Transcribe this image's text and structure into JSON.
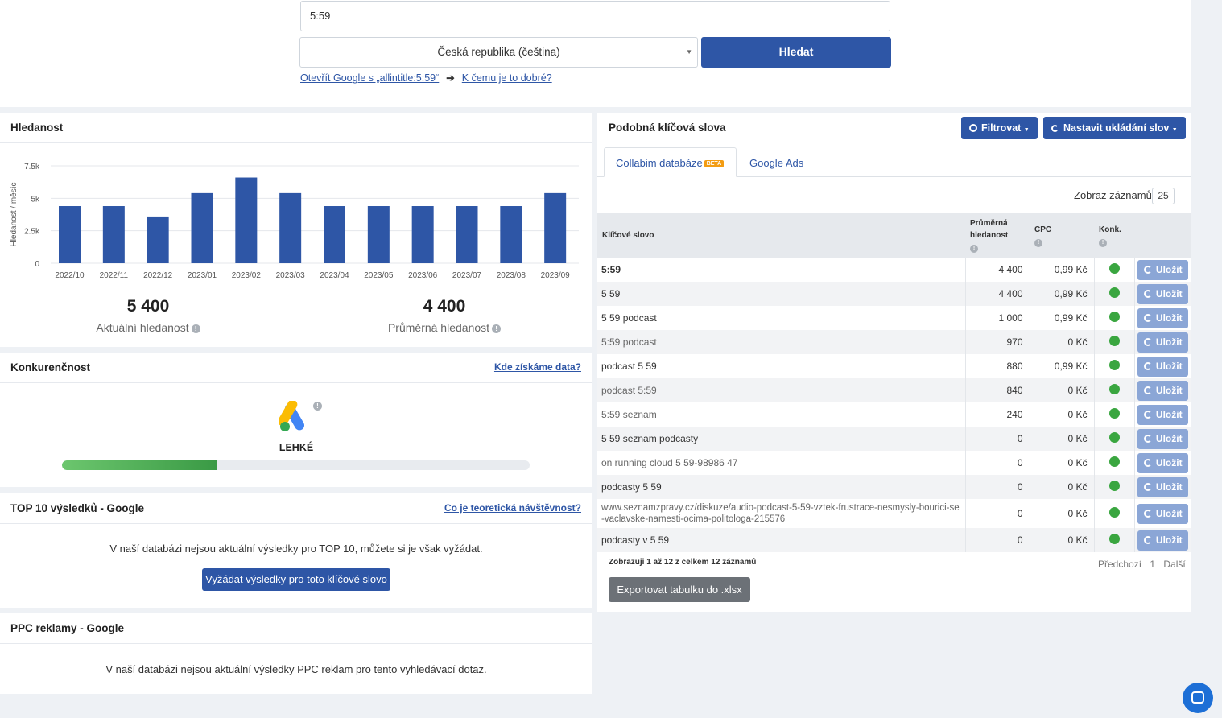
{
  "search": {
    "query": "5:59",
    "country": "Česká republika (čeština)",
    "button": "Hledat"
  },
  "links": {
    "allintitle": "Otevřít Google s „allintitle:5:59“",
    "arrow": "➔",
    "why": "K čemu je to dobré?"
  },
  "searchvolume": {
    "title": "Hledanost",
    "current_value": "5 400",
    "current_label": "Aktuální hledanost",
    "avg_value": "4 400",
    "avg_label": "Průměrná hledanost"
  },
  "chart_data": {
    "type": "bar",
    "categories": [
      "2022/10",
      "2022/11",
      "2022/12",
      "2023/01",
      "2023/02",
      "2023/03",
      "2023/04",
      "2023/05",
      "2023/06",
      "2023/07",
      "2023/08",
      "2023/09"
    ],
    "values": [
      4400,
      4400,
      3600,
      5400,
      6600,
      5400,
      4400,
      4400,
      4400,
      4400,
      4400,
      5400
    ],
    "ylabel": "Hledanost / měsíc",
    "yticks": [
      "0",
      "2.5k",
      "5k",
      "7.5k"
    ],
    "ylim": [
      0,
      7500
    ],
    "grid": true,
    "color": "#2e56a6"
  },
  "competition": {
    "title": "Konkurenčnost",
    "link": "Kde získáme data?",
    "level": "LEHKÉ",
    "level_fraction": 0.33
  },
  "top10": {
    "title": "TOP 10 výsledků - Google",
    "link": "Co je teoretická návštěvnost?",
    "message": "V naší databázi nejsou aktuální výsledky pro TOP 10, můžete si je však vyžádat.",
    "button": "Vyžádat výsledky pro toto klíčové slovo"
  },
  "ppc": {
    "title": "PPC reklamy - Google",
    "message": "V naší databázi nejsou aktuální výsledky PPC reklam pro tento vyhledávací dotaz."
  },
  "similar": {
    "title": "Podobná klíčová slova",
    "filter_button": "Filtrovat",
    "save_settings_button": "Nastavit ukládání slov",
    "tabs": [
      "Collabim databáze",
      "Google Ads"
    ],
    "beta": "BETA",
    "show_records_label": "Zobraz záznamů",
    "show_records_value": "25",
    "headers": {
      "keyword": "Klíčové slovo",
      "avg": "Průměrná hledanost",
      "cpc": "CPC",
      "comp": "Konk."
    },
    "save_label": "Uložit",
    "rows": [
      {
        "keyword": "5:59",
        "avg": "4 400",
        "cpc": "0,99 Kč"
      },
      {
        "keyword": "5 59",
        "avg": "4 400",
        "cpc": "0,99 Kč"
      },
      {
        "keyword": "5 59 podcast",
        "avg": "1 000",
        "cpc": "0,99 Kč"
      },
      {
        "keyword": "5:59 podcast",
        "avg": "970",
        "cpc": "0 Kč"
      },
      {
        "keyword": "podcast 5 59",
        "avg": "880",
        "cpc": "0,99 Kč"
      },
      {
        "keyword": "podcast 5:59",
        "avg": "840",
        "cpc": "0 Kč"
      },
      {
        "keyword": "5:59 seznam",
        "avg": "240",
        "cpc": "0 Kč"
      },
      {
        "keyword": "5 59 seznam podcasty",
        "avg": "0",
        "cpc": "0 Kč"
      },
      {
        "keyword": "on running cloud 5 59-98986 47",
        "avg": "0",
        "cpc": "0 Kč"
      },
      {
        "keyword": "podcasty 5 59",
        "avg": "0",
        "cpc": "0 Kč"
      },
      {
        "keyword": "www.seznamzpravy.cz/diskuze/audio-podcast-5-59-vztek-frustrace-nesmysly-bourici-se-vaclavske-namesti-ocima-politologa-215576",
        "avg": "0",
        "cpc": "0 Kč"
      },
      {
        "keyword": "podcasty v 5 59",
        "avg": "0",
        "cpc": "0 Kč"
      }
    ],
    "summary": "Zobrazuji 1 až 12 z celkem 12 záznamů",
    "prev": "Předchozí",
    "page": "1",
    "next": "Další",
    "export_button": "Exportovat tabulku do .xlsx"
  }
}
